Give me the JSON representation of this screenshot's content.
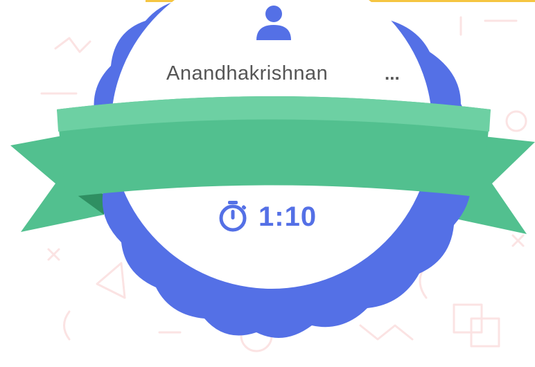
{
  "player": {
    "name": "Anandhakrishnan",
    "overflow_indicator": "..."
  },
  "timer": {
    "value": "1:10"
  },
  "icons": {
    "user": "user-icon",
    "timer": "stopwatch-icon"
  },
  "colors": {
    "badge_blue": "#5470e6",
    "badge_white": "#ffffff",
    "ribbon_green": "#52c08f",
    "ribbon_green_light": "#6dd0a3",
    "ribbon_dark": "#2f8f62",
    "text_gray": "#555555",
    "accent_yellow": "#f5c542",
    "doodle_pink": "#fbe3e3"
  }
}
